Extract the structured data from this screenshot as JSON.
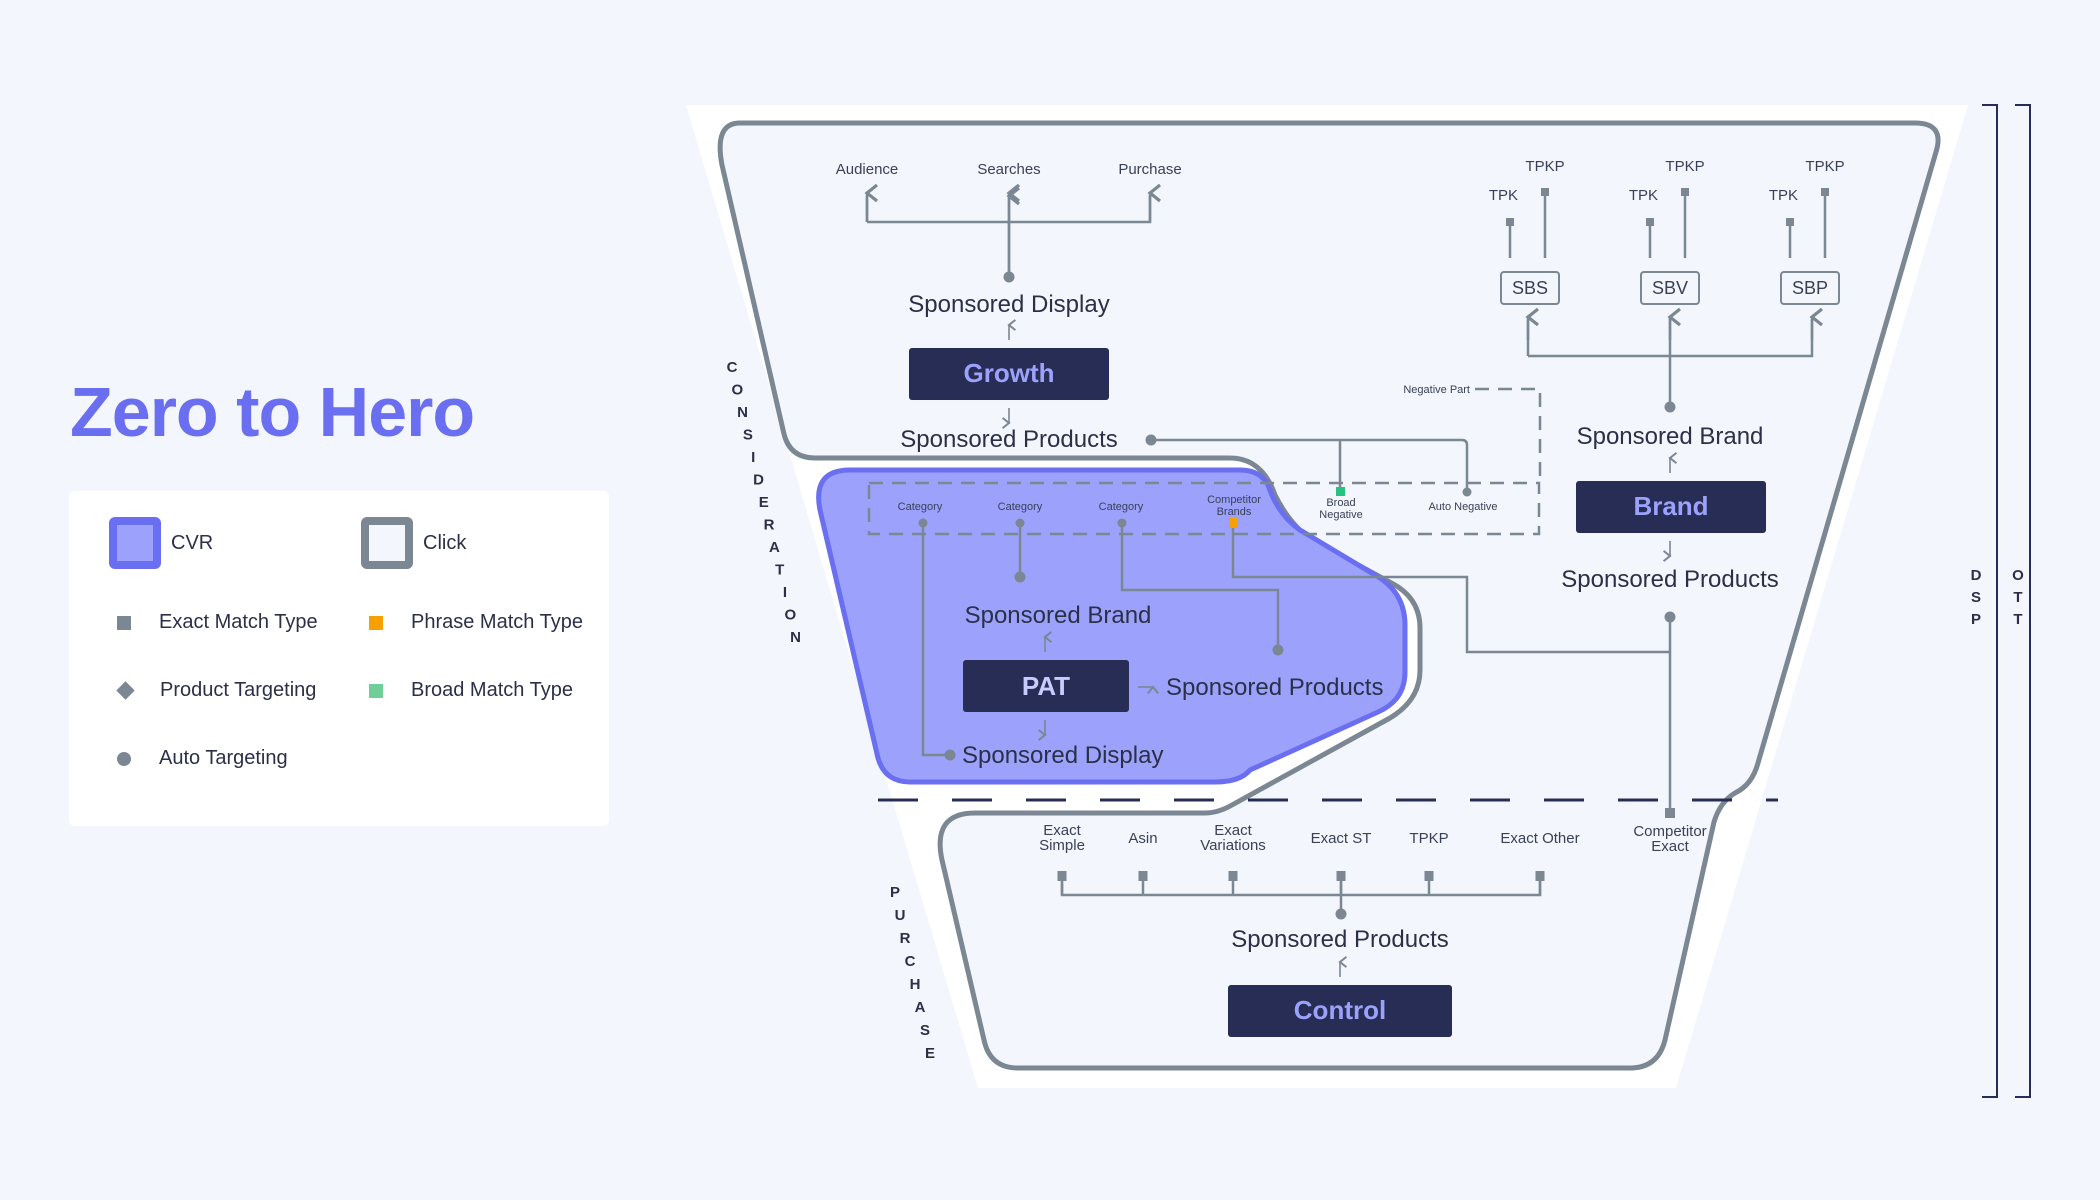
{
  "title": "Zero to Hero",
  "colors": {
    "accent": "#6a6ef0",
    "cvr_fill": "#9ca2fb",
    "click_stroke": "#7b8792",
    "node_box": "#272d54",
    "exact": "#7b8792",
    "phrase": "#f7a000",
    "broad": "#26c281"
  },
  "legend": {
    "cvr": "CVR",
    "click": "Click",
    "exact_match": "Exact Match Type",
    "phrase_match": "Phrase Match Type",
    "product_targeting": "Product Targeting",
    "broad_match": "Broad Match Type",
    "auto_targeting": "Auto Targeting"
  },
  "stages": {
    "consideration": "CONSIDERATION",
    "purchase": "PURCHASE",
    "dsp": "DSP",
    "ott": "OTT"
  },
  "growth": {
    "box": "Growth",
    "display": "Sponsored Display",
    "products": "Sponsored Products",
    "targets": [
      "Audience",
      "Searches",
      "Purchase"
    ]
  },
  "brand": {
    "box": "Brand",
    "sponsored_brand": "Sponsored Brand",
    "products": "Sponsored Products",
    "formats": [
      "SBS",
      "SBV",
      "SBP"
    ],
    "tpk": "TPK",
    "tpkp": "TPKP"
  },
  "negative": {
    "label": "Negative Part",
    "items": [
      "Category",
      "Category",
      "Category",
      "Competitor Brands",
      "Broad Negative",
      "Auto Negative"
    ]
  },
  "pat": {
    "box": "PAT",
    "brand": "Sponsored Brand",
    "products": "Sponsored Products",
    "display": "Sponsored Display"
  },
  "control": {
    "box": "Control",
    "products": "Sponsored Products",
    "targets": [
      "Exact Simple",
      "Asin",
      "Exact Variations",
      "Exact ST",
      "TPKP",
      "Exact Other"
    ],
    "competitor": "Competitor Exact"
  }
}
